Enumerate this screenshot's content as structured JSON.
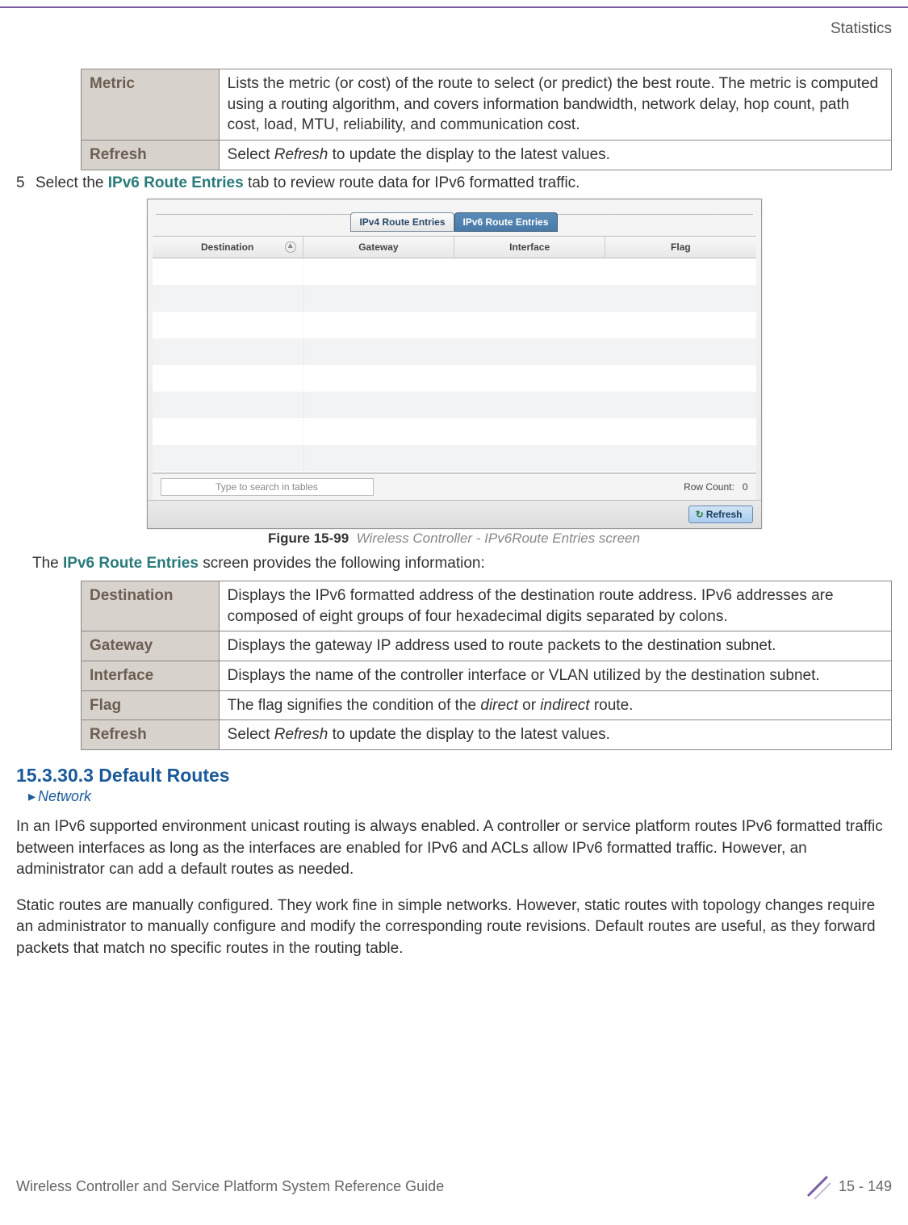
{
  "header": {
    "section_label": "Statistics"
  },
  "table1": {
    "rows": [
      {
        "label": "Metric",
        "desc": "Lists the metric (or cost) of the route to select (or predict) the best route. The metric is computed using a routing algorithm, and covers information bandwidth, network delay, hop count, path cost, load, MTU, reliability, and communication cost."
      },
      {
        "label": "Refresh",
        "desc_pre": "Select ",
        "desc_em": "Refresh",
        "desc_post": " to update the display to the latest values."
      }
    ]
  },
  "step5": {
    "num": "5",
    "pre": "Select the ",
    "bold": "IPv6 Route Entries",
    "post": " tab to review route data for IPv6 formatted traffic."
  },
  "ui": {
    "tabs": {
      "inactive": "IPv4 Route Entries",
      "active": "IPv6 Route Entries"
    },
    "columns": [
      "Destination",
      "Gateway",
      "Interface",
      "Flag"
    ],
    "search_placeholder": "Type to search in tables",
    "row_count_label": "Row Count:",
    "row_count_value": "0",
    "refresh_btn": "Refresh"
  },
  "figure": {
    "label": "Figure 15-99",
    "desc": "Wireless Controller - IPv6Route Entries screen"
  },
  "para_after_figure": {
    "pre": "The ",
    "bold": "IPv6 Route Entries",
    "post": " screen provides the following information:"
  },
  "table2": {
    "rows": [
      {
        "label": "Destination",
        "desc": "Displays the IPv6 formatted address of the destination route address. IPv6 addresses are composed of eight groups of four hexadecimal digits separated by colons."
      },
      {
        "label": "Gateway",
        "desc": "Displays the gateway IP address used to route packets to the destination subnet."
      },
      {
        "label": "Interface",
        "desc": "Displays the name of the controller interface or VLAN utilized by the destination subnet."
      },
      {
        "label": "Flag",
        "desc_pre": "The flag signifies the condition of the ",
        "desc_em": "direct",
        "desc_mid": " or ",
        "desc_em2": "indirect",
        "desc_post": " route."
      },
      {
        "label": "Refresh",
        "desc_pre": "Select ",
        "desc_em": "Refresh",
        "desc_post": " to update the display to the latest values."
      }
    ]
  },
  "section": {
    "heading": "15.3.30.3  Default Routes",
    "breadcrumb": "Network"
  },
  "body_paras": [
    "In an IPv6 supported environment unicast routing is always enabled. A controller or service platform routes IPv6 formatted traffic between interfaces as long as the interfaces are enabled for IPv6 and ACLs allow IPv6 formatted traffic. However, an administrator can add a default routes as needed.",
    "Static routes are manually configured. They work fine in simple networks. However, static routes with topology changes require an administrator to manually configure and modify the corresponding route revisions. Default routes are useful, as they forward packets that match no specific routes in the routing table."
  ],
  "footer": {
    "doc_title": "Wireless Controller and Service Platform System Reference Guide",
    "page_num": "15 - 149"
  }
}
